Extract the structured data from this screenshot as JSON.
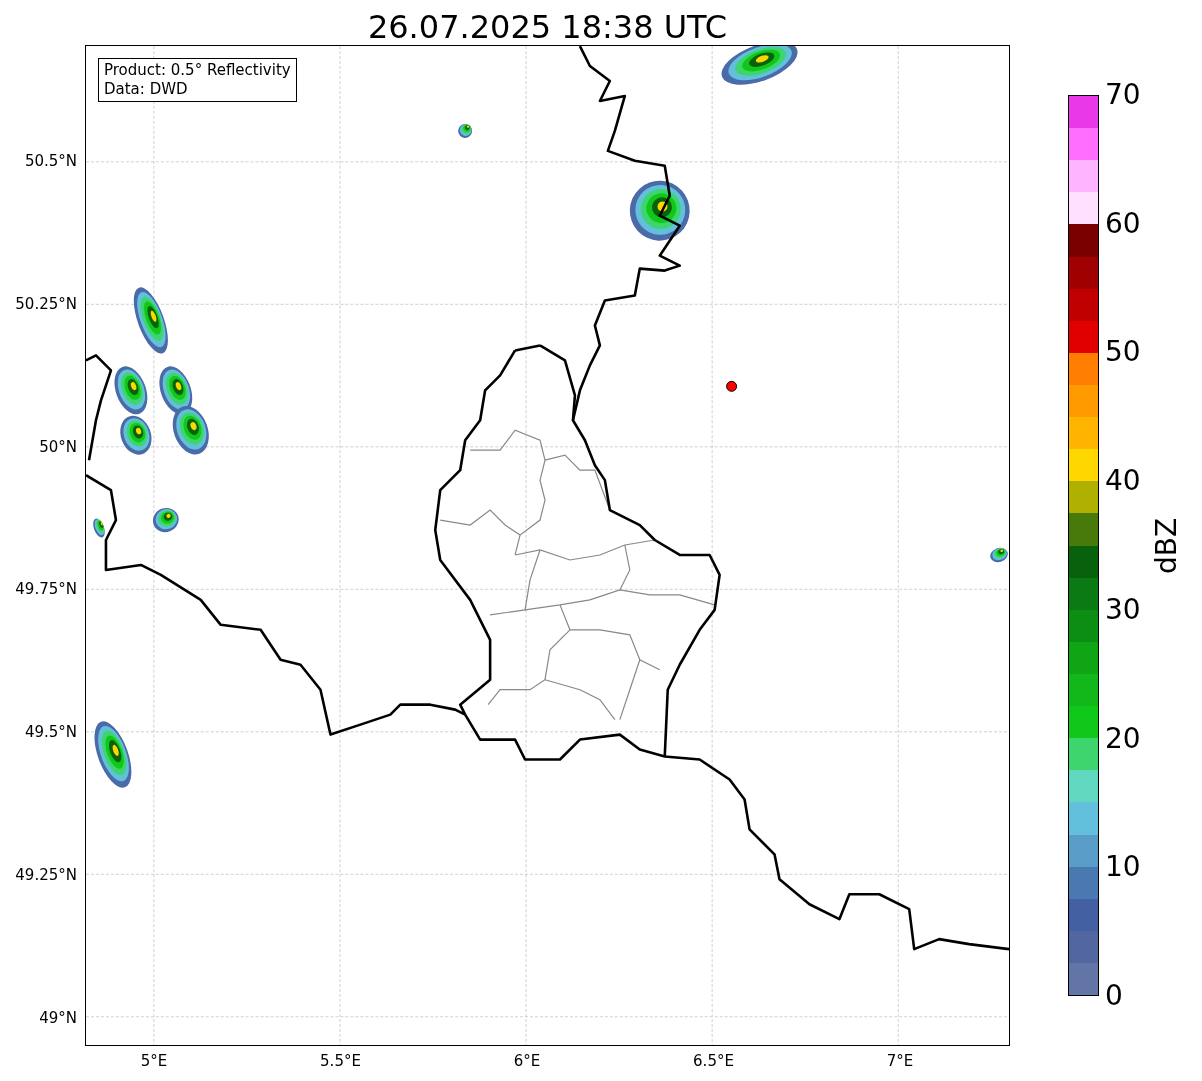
{
  "title": "26.07.2025 18:38 UTC",
  "info_box": [
    "Product: 0.5° Reflectivity",
    "Data: DWD"
  ],
  "lat_ticks": [
    "50.5°N",
    "50.25°N",
    "50°N",
    "49.75°N",
    "49.5°N",
    "49.25°N",
    "49°N"
  ],
  "lon_ticks": [
    "5°E",
    "5.5°E",
    "6°E",
    "6.5°E",
    "7°E"
  ],
  "colorbar": {
    "label": "dBZ",
    "ticks": [
      "70",
      "60",
      "50",
      "40",
      "30",
      "20",
      "10",
      "0"
    ],
    "bins": [
      {
        "color": "#e838e8"
      },
      {
        "color": "#ff6eff"
      },
      {
        "color": "#ffb4ff"
      },
      {
        "color": "#ffe0ff"
      },
      {
        "color": "#7a0000"
      },
      {
        "color": "#a00000"
      },
      {
        "color": "#c00000"
      },
      {
        "color": "#e00000"
      },
      {
        "color": "#ff7d00"
      },
      {
        "color": "#ff9a00"
      },
      {
        "color": "#ffb400"
      },
      {
        "color": "#ffd700"
      },
      {
        "color": "#b0b000"
      },
      {
        "color": "#487a0a"
      },
      {
        "color": "#08620c"
      },
      {
        "color": "#0a7a14"
      },
      {
        "color": "#0c8e15"
      },
      {
        "color": "#0fa515"
      },
      {
        "color": "#12b81a"
      },
      {
        "color": "#10c81a"
      },
      {
        "color": "#3ed56e"
      },
      {
        "color": "#60d8c0"
      },
      {
        "color": "#62c0dc"
      },
      {
        "color": "#5a9cc8"
      },
      {
        "color": "#4a78b0"
      },
      {
        "color": "#4360a3"
      },
      {
        "color": "#5266a0"
      },
      {
        "color": "#6374a6"
      }
    ]
  }
}
